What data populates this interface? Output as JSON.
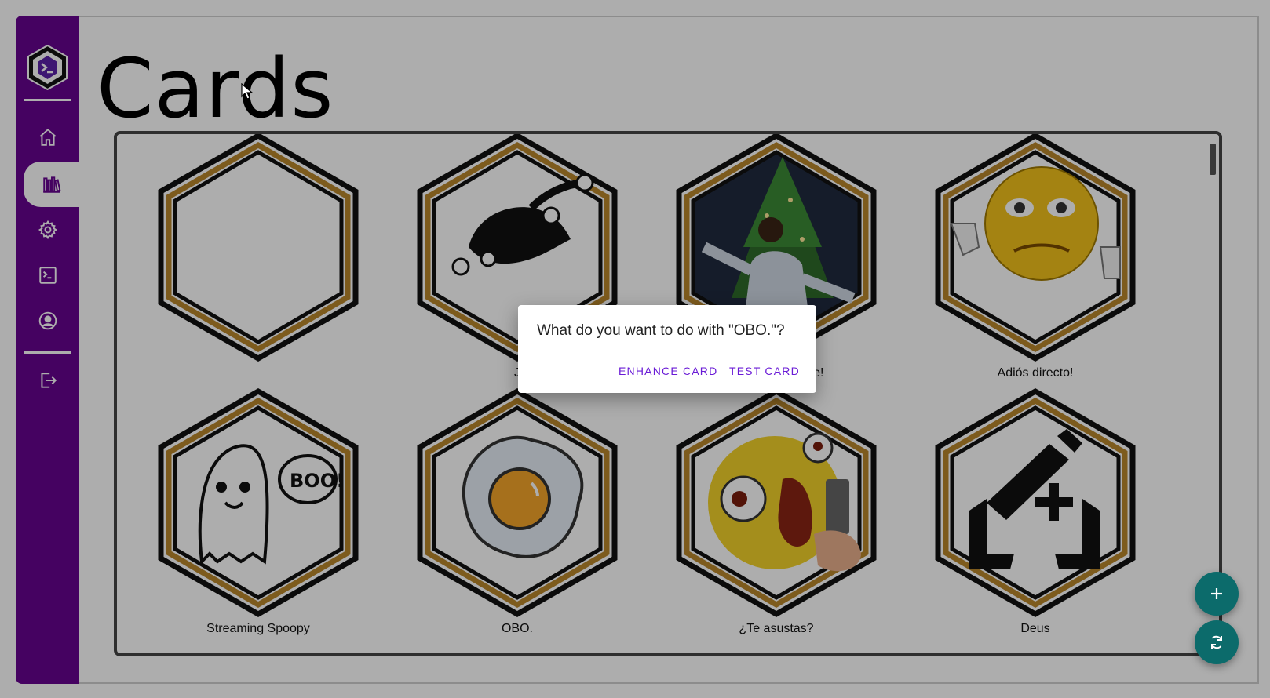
{
  "page": {
    "title": "Cards"
  },
  "cards": [
    {
      "label": "",
      "image": "blank"
    },
    {
      "label": "J",
      "image": "jester-hat"
    },
    {
      "label": "06 de Diciembre!",
      "image": "christmas-tree-man"
    },
    {
      "label": "Adiós directo!",
      "image": "sad-emoji-thumbs-down"
    },
    {
      "label": "Streaming Spoopy",
      "image": "ghost-boo"
    },
    {
      "label": "OBO.",
      "image": "fried-egg"
    },
    {
      "label": "¿Te asustas?",
      "image": "scared-emoji-gun"
    },
    {
      "label": "Deus",
      "image": "edit-add-hands"
    }
  ],
  "dialog": {
    "message": "What do you want to do with \"OBO.\"?",
    "enhance_label": "ENHANCE CARD",
    "test_label": "TEST CARD"
  },
  "colors": {
    "sidebar": "#66048f",
    "accent": "#6a1bd6",
    "fab": "#0c6b6b",
    "hex_gold": "#b8862c"
  },
  "nav_icons": [
    "home-icon",
    "library-icon",
    "settings-icon",
    "terminal-icon",
    "account-icon",
    "logout-icon"
  ]
}
